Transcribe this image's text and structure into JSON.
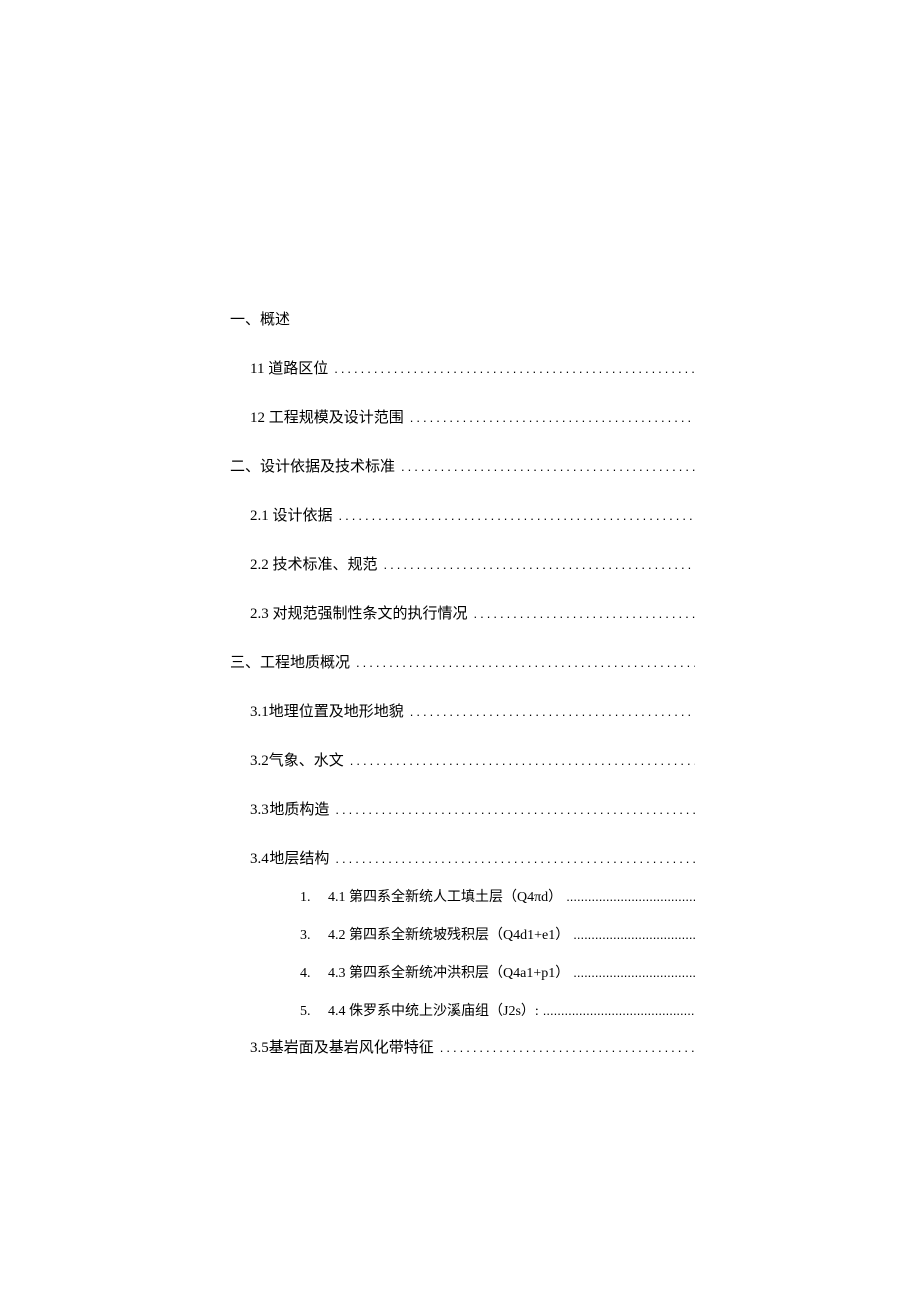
{
  "toc": {
    "s1": {
      "title": "一、概述"
    },
    "s1_1": {
      "title": "11 道路区位"
    },
    "s1_2": {
      "title": "12 工程规模及设计范围"
    },
    "s2": {
      "title": "二、设计依据及技术标准"
    },
    "s2_1": {
      "title": "2.1 设计依据"
    },
    "s2_2": {
      "title": "2.2 技术标准、规范"
    },
    "s2_3": {
      "title": "2.3 对规范强制性条文的执行情况"
    },
    "s3": {
      "title": "三、工程地质概况"
    },
    "s3_1": {
      "num": "3.1",
      "title": "地理位置及地形地貌"
    },
    "s3_2": {
      "num": "3.2",
      "title": "气象、水文"
    },
    "s3_3": {
      "num": "3.3",
      "title": "地质构造"
    },
    "s3_4": {
      "num": "3.4",
      "title": "地层结构"
    },
    "s3_4_items": [
      {
        "num": "1.",
        "title": "4.1 第四系全新统人工填土层（Q4πd）"
      },
      {
        "num": "3.",
        "title": "4.2 第四系全新统坡残积层（Q4d1+e1）"
      },
      {
        "num": "4.",
        "title": "4.3 第四系全新统冲洪积层（Q4a1+p1）"
      },
      {
        "num": "5.",
        "title": "4.4 侏罗系中统上沙溪庙组（J2s）:"
      }
    ],
    "s3_5": {
      "num": "3.5",
      "title": "基岩面及基岩风化带特征"
    }
  },
  "dots": "......................................................................................................................",
  "subdots": ".................................................................................................."
}
